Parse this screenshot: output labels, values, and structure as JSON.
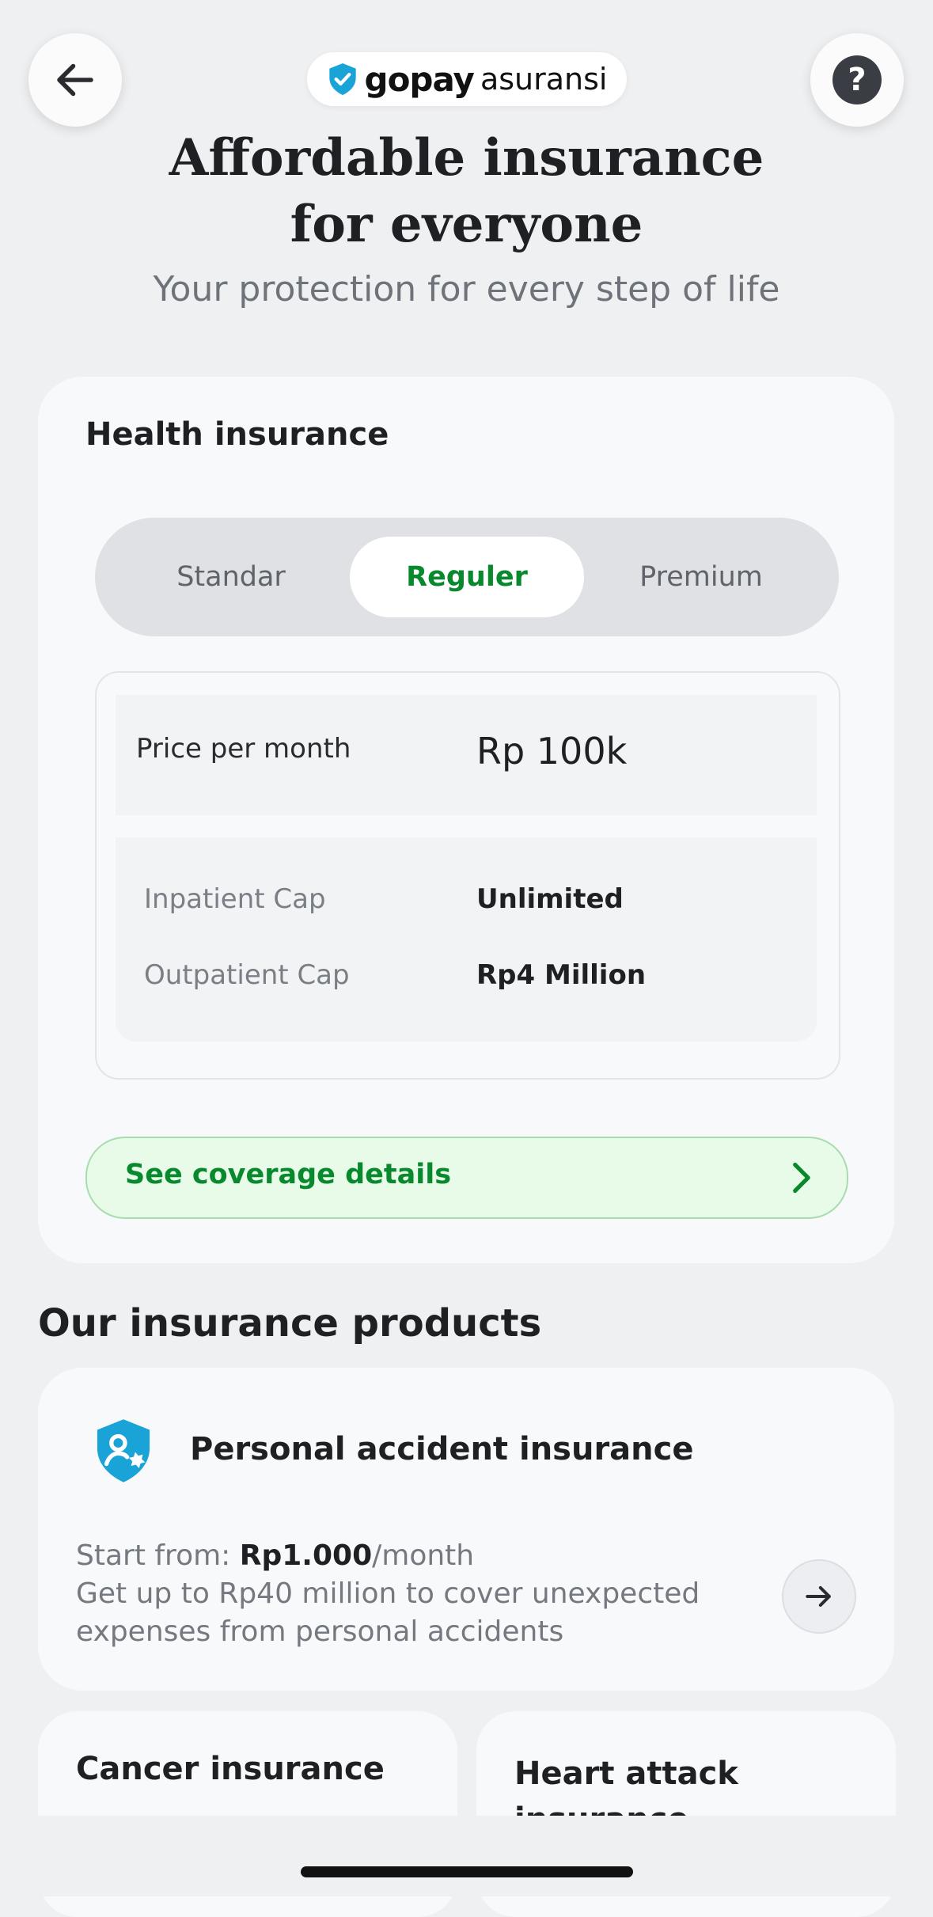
{
  "header": {
    "brand_primary": "gopay",
    "brand_secondary": "asuransi",
    "back_icon": "arrow-left-icon",
    "help_icon": "question-icon",
    "help_glyph": "?"
  },
  "hero": {
    "title": "Affordable insurance for everyone",
    "subtitle": "Your protection for every step of life"
  },
  "health": {
    "title": "Health insurance",
    "tabs": [
      {
        "label": "Standar",
        "active": false
      },
      {
        "label": "Reguler",
        "active": true
      },
      {
        "label": "Premium",
        "active": false
      }
    ],
    "price_label": "Price per month",
    "price_value": "Rp 100k",
    "caps": [
      {
        "label": "Inpatient Cap",
        "value": "Unlimited"
      },
      {
        "label": "Outpatient Cap",
        "value": "Rp4 Million"
      }
    ],
    "cta_label": "See coverage details"
  },
  "products": {
    "section_title": "Our insurance products",
    "featured": {
      "title": "Personal accident insurance",
      "start_prefix": "Start from: ",
      "start_price": "Rp1.000",
      "start_suffix": "/month",
      "description": "Get up to Rp40 million to cover unexpected expenses from personal accidents"
    },
    "cards": [
      {
        "title": "Cancer insurance"
      },
      {
        "title": "Heart attack insurance"
      }
    ]
  },
  "colors": {
    "accent_green": "#08892e",
    "brand_blue": "#1aa3d6",
    "background": "#eff0f2"
  }
}
